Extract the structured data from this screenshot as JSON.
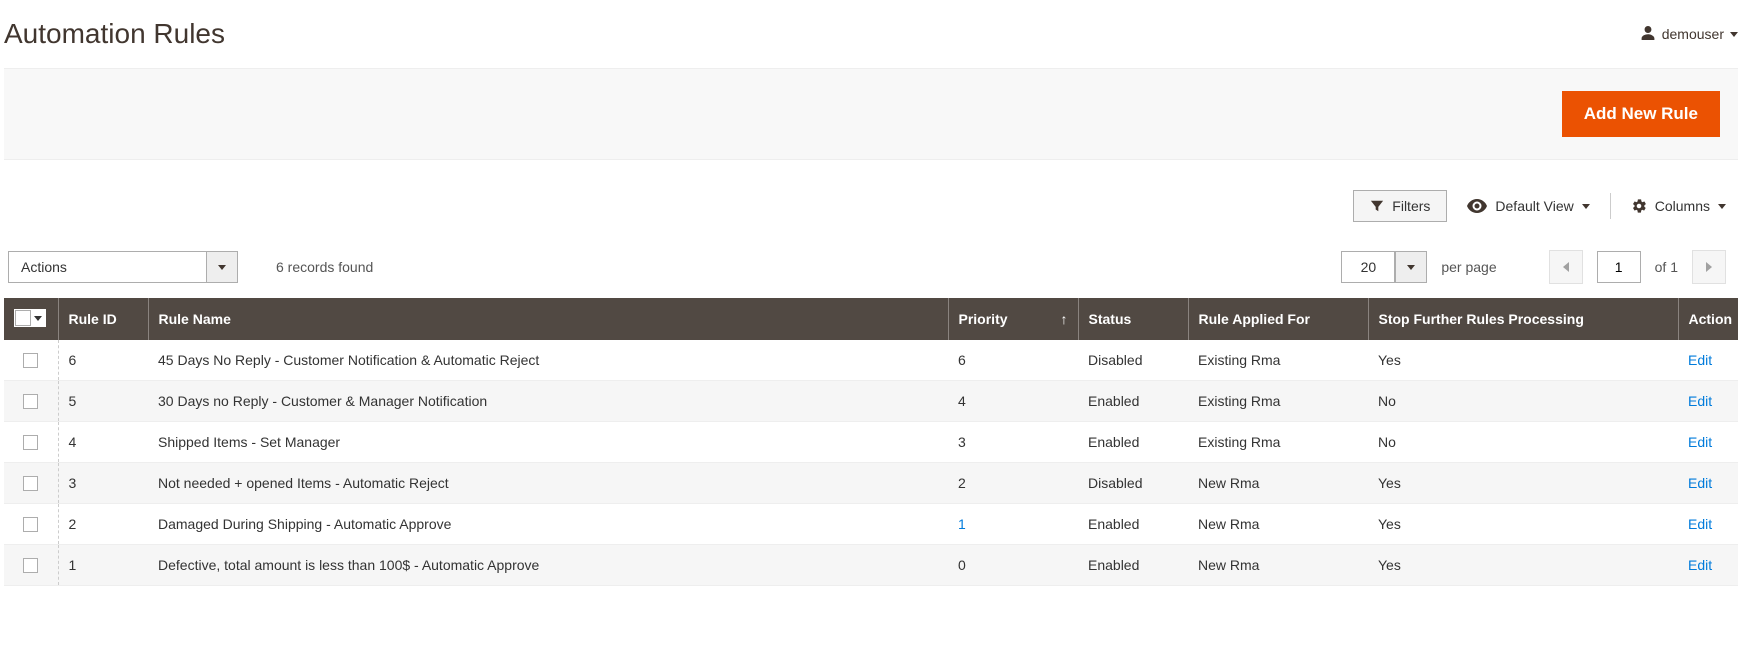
{
  "header": {
    "title": "Automation Rules",
    "username": "demouser"
  },
  "actionbar": {
    "add_new_rule": "Add New Rule"
  },
  "filtersbar": {
    "filters": "Filters",
    "default_view": "Default View",
    "columns": "Columns"
  },
  "controls": {
    "actions_label": "Actions",
    "records_found": "6 records found",
    "per_page_value": "20",
    "per_page_label": "per page",
    "page_value": "1",
    "of_total": "of 1"
  },
  "table": {
    "headers": {
      "rule_id": "Rule ID",
      "rule_name": "Rule Name",
      "priority": "Priority",
      "status": "Status",
      "applied_for": "Rule Applied For",
      "stop_further": "Stop Further Rules Processing",
      "action": "Action"
    },
    "rows": [
      {
        "rule_id": "6",
        "rule_name": "45 Days No Reply - Customer Notification & Automatic Reject",
        "priority": "6",
        "priority_link": false,
        "status": "Disabled",
        "applied_for": "Existing Rma",
        "stop_further": "Yes",
        "action": "Edit"
      },
      {
        "rule_id": "5",
        "rule_name": "30 Days no Reply - Customer & Manager Notification",
        "priority": "4",
        "priority_link": false,
        "status": "Enabled",
        "applied_for": "Existing Rma",
        "stop_further": "No",
        "action": "Edit"
      },
      {
        "rule_id": "4",
        "rule_name": "Shipped Items - Set Manager",
        "priority": "3",
        "priority_link": false,
        "status": "Enabled",
        "applied_for": "Existing Rma",
        "stop_further": "No",
        "action": "Edit"
      },
      {
        "rule_id": "3",
        "rule_name": "Not needed + opened Items - Automatic Reject",
        "priority": "2",
        "priority_link": false,
        "status": "Disabled",
        "applied_for": "New Rma",
        "stop_further": "Yes",
        "action": "Edit"
      },
      {
        "rule_id": "2",
        "rule_name": "Damaged During Shipping - Automatic Approve",
        "priority": "1",
        "priority_link": true,
        "status": "Enabled",
        "applied_for": "New Rma",
        "stop_further": "Yes",
        "action": "Edit"
      },
      {
        "rule_id": "1",
        "rule_name": "Defective, total amount is less than 100$ - Automatic Approve",
        "priority": "0",
        "priority_link": false,
        "status": "Enabled",
        "applied_for": "New Rma",
        "stop_further": "Yes",
        "action": "Edit"
      }
    ]
  }
}
